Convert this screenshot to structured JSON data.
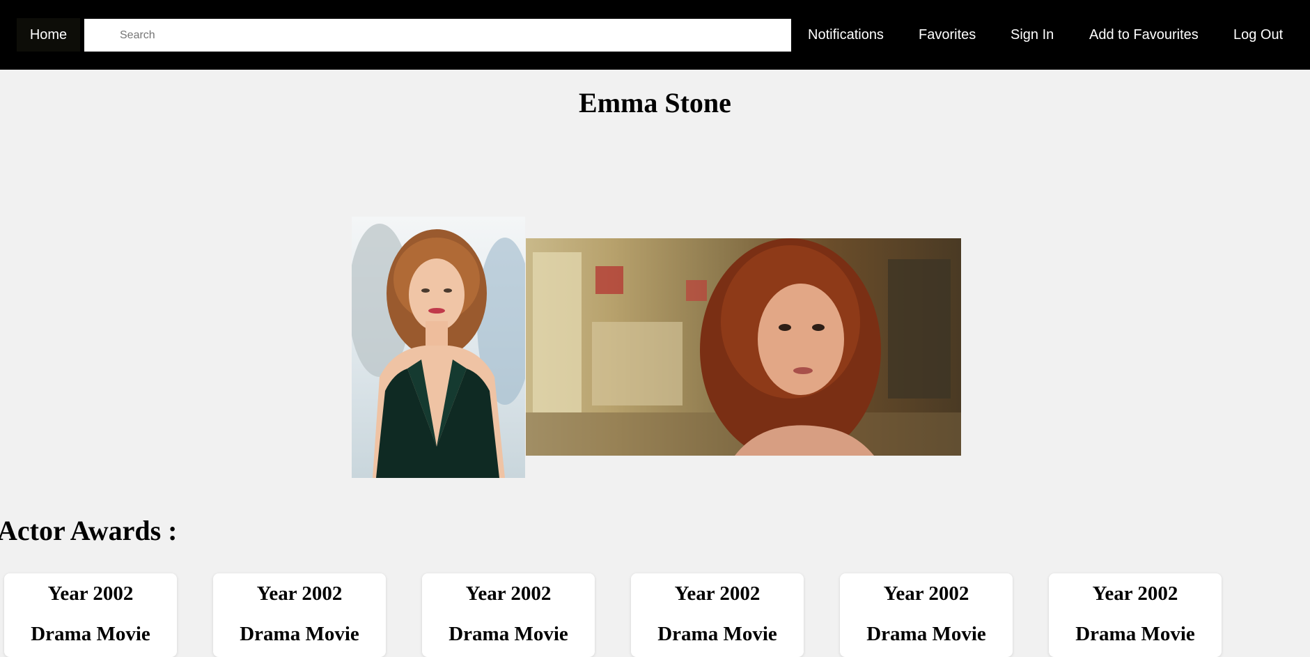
{
  "nav": {
    "home_label": "Home",
    "search_placeholder": "Search",
    "links": [
      "Notifications",
      "Favorites",
      "Sign In",
      "Add to Favourites",
      "Log Out"
    ]
  },
  "actor": {
    "name": "Emma Stone"
  },
  "awards": {
    "heading": "Actor Awards :",
    "items": [
      {
        "year": "Year 2002",
        "category": "Drama Movie"
      },
      {
        "year": "Year 2002",
        "category": "Drama Movie"
      },
      {
        "year": "Year 2002",
        "category": "Drama Movie"
      },
      {
        "year": "Year 2002",
        "category": "Drama Movie"
      },
      {
        "year": "Year 2002",
        "category": "Drama Movie"
      },
      {
        "year": "Year 2002",
        "category": "Drama Movie"
      }
    ]
  },
  "colors": {
    "nav_bg": "#000000",
    "page_bg": "#f1f1f1",
    "card_bg": "#ffffff"
  }
}
